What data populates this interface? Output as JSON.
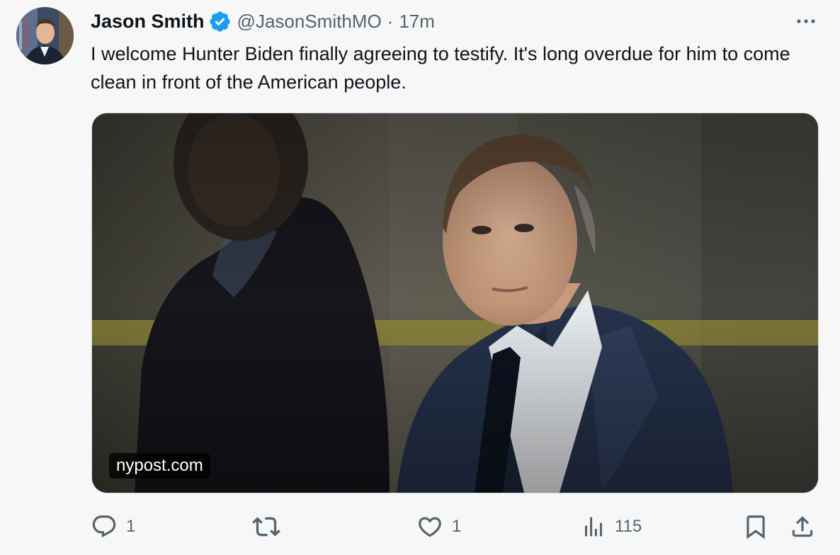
{
  "author": {
    "display_name": "Jason Smith",
    "handle": "@JasonSmithMO",
    "separator": "·",
    "time": "17m",
    "verified": true
  },
  "tweet": {
    "text": "I welcome Hunter Biden finally agreeing to testify. It's long overdue for him to come clean in front of the American people."
  },
  "media": {
    "domain": "nypost.com"
  },
  "actions": {
    "replies": "1",
    "retweets": "",
    "likes": "1",
    "views": "115"
  },
  "icons": {
    "more": "more-dots-icon",
    "reply": "reply-icon",
    "retweet": "retweet-icon",
    "like": "heart-icon",
    "views": "views-chart-icon",
    "bookmark": "bookmark-icon",
    "share": "share-icon",
    "verified": "verified-badge-icon"
  },
  "colors": {
    "verified": "#1d9bf0",
    "text": "#0f1419",
    "muted": "#536471",
    "background": "#f7f7f7"
  }
}
